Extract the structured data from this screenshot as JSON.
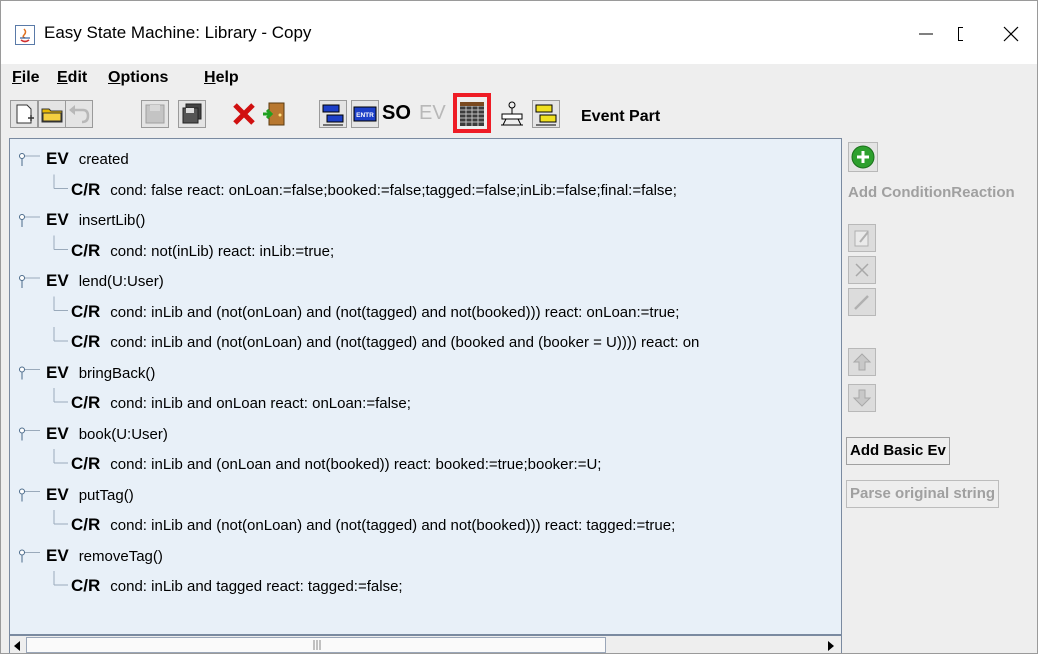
{
  "window": {
    "title": "Easy State Machine: Library - Copy",
    "controls": {
      "minimize": "—",
      "maximize": "☐",
      "close": "✕"
    }
  },
  "menu": [
    {
      "key": "F",
      "rest": "ile"
    },
    {
      "key": "E",
      "rest": "dit"
    },
    {
      "key": "O",
      "rest": "ptions"
    },
    {
      "key": "H",
      "rest": "elp"
    }
  ],
  "toolbar": {
    "so_label": "SO",
    "ev_label": "EV",
    "entr_label": "ENTR",
    "section_label": "Event Part",
    "highlight_color": "#ee1c25",
    "icons": [
      "new-file-icon",
      "open-folder-icon",
      "undo-icon",
      "save-icon",
      "save-all-icon",
      "delete-icon",
      "exit-icon",
      "state-left-icon",
      "entr-icon",
      "so-icon",
      "ev-icon",
      "table-icon",
      "transition-icon",
      "state-right-icon"
    ]
  },
  "tree": {
    "ev_badge": "EV",
    "cr_badge": "C/R",
    "items": [
      {
        "kind": "ev",
        "text": "created"
      },
      {
        "kind": "cr",
        "text": "cond: false  react: onLoan:=false;booked:=false;tagged:=false;inLib:=false;final:=false;"
      },
      {
        "kind": "ev",
        "text": "insertLib()"
      },
      {
        "kind": "cr",
        "text": "cond: not(inLib)  react: inLib:=true;"
      },
      {
        "kind": "ev",
        "text": "lend(U:User)"
      },
      {
        "kind": "cr",
        "text": "cond: inLib and (not(onLoan) and (not(tagged) and not(booked)))  react: onLoan:=true;"
      },
      {
        "kind": "cr",
        "text": "cond: inLib and (not(onLoan) and (not(tagged) and (booked and (booker = U))))  react: on"
      },
      {
        "kind": "ev",
        "text": "bringBack()"
      },
      {
        "kind": "cr",
        "text": "cond: inLib and onLoan  react: onLoan:=false;"
      },
      {
        "kind": "ev",
        "text": "book(U:User)"
      },
      {
        "kind": "cr",
        "text": "cond: inLib and (onLoan and not(booked))  react: booked:=true;booker:=U;"
      },
      {
        "kind": "ev",
        "text": "putTag()"
      },
      {
        "kind": "cr",
        "text": "cond: inLib and (not(onLoan) and (not(tagged) and not(booked)))  react: tagged:=true;"
      },
      {
        "kind": "ev",
        "text": "removeTag()"
      },
      {
        "kind": "cr",
        "text": "cond: inLib and tagged  react: tagged:=false;"
      }
    ]
  },
  "right_panel": {
    "add_condition_reaction": "Add ConditionReaction",
    "add_basic_ev": "Add Basic Ev",
    "parse_original_string": "Parse original string",
    "side_icons": [
      "edit-icon",
      "remove-icon",
      "pencil-icon",
      "move-up-icon",
      "move-down-icon"
    ]
  }
}
